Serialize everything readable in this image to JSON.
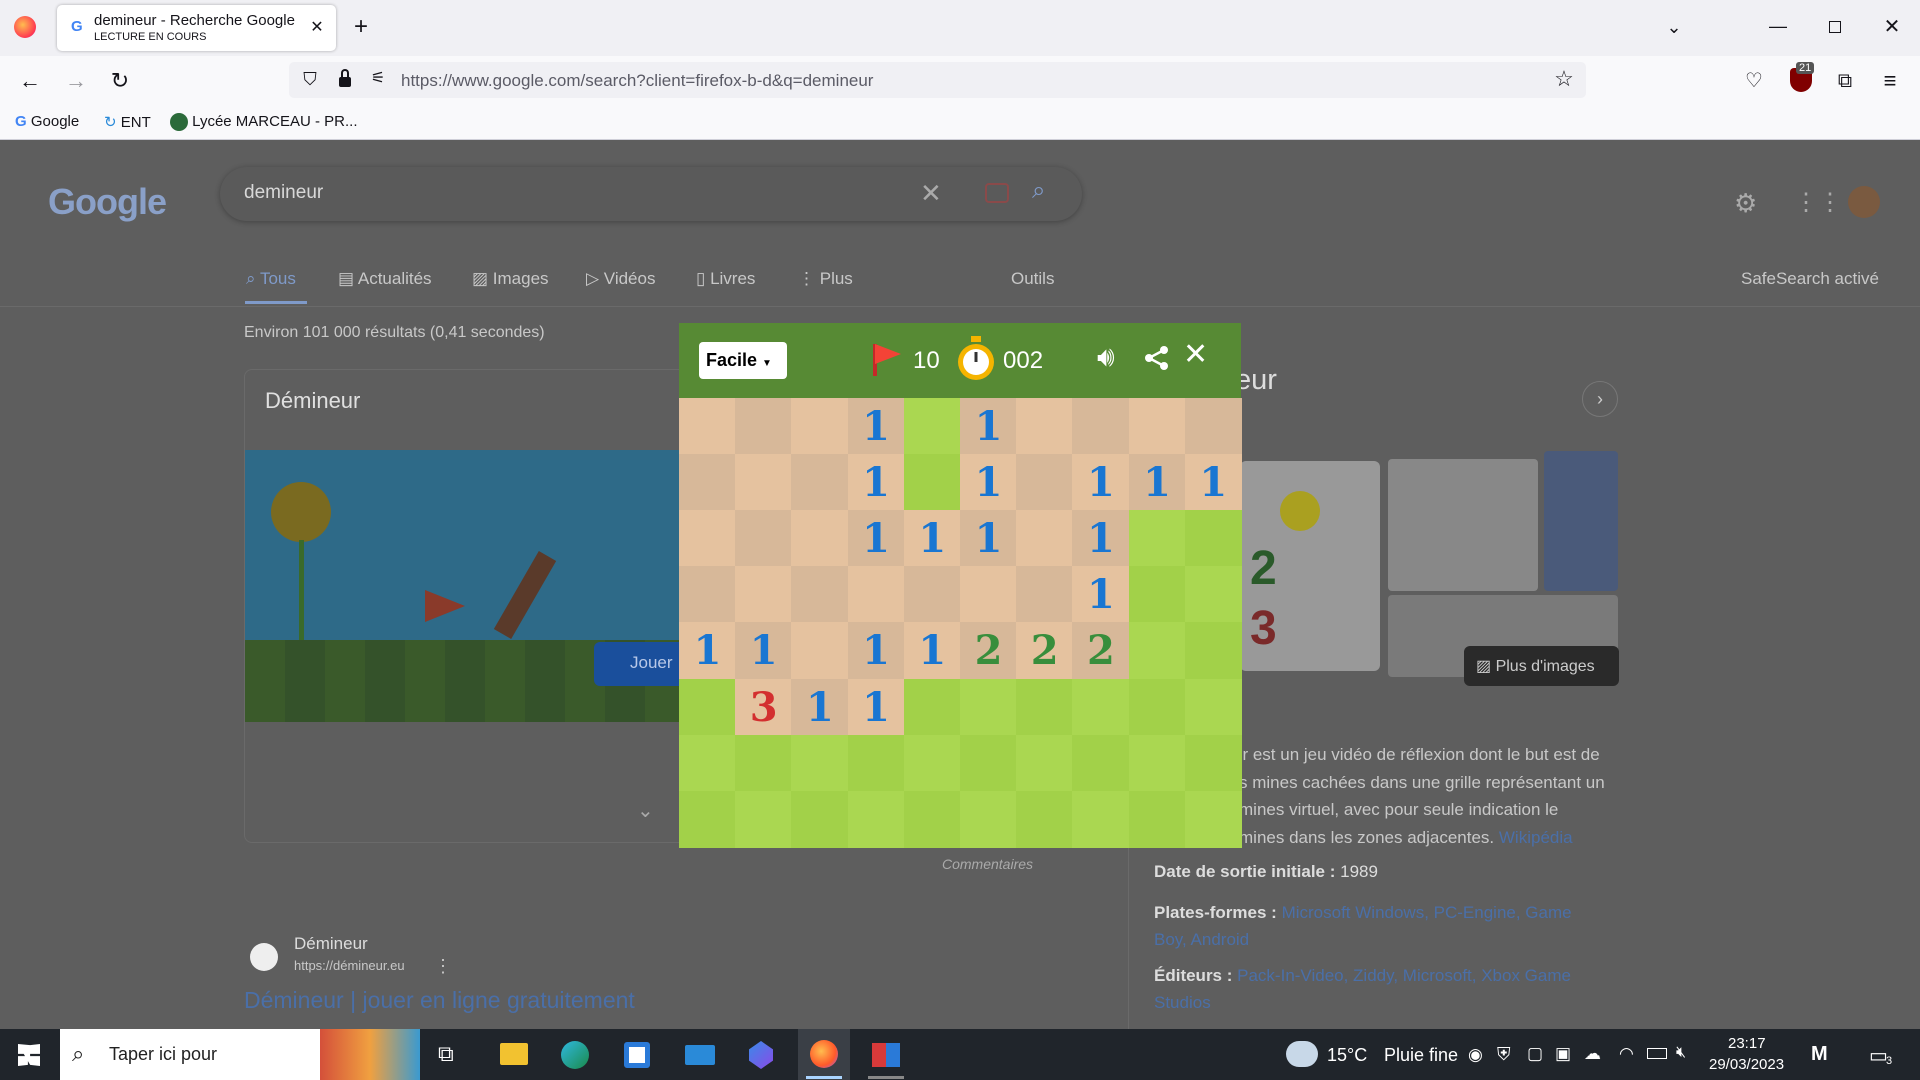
{
  "browser": {
    "tab_title": "demineur - Recherche Google",
    "tab_subtitle": "LECTURE EN COURS",
    "url": "https://www.google.com/search?client=firefox-b-d&q=demineur",
    "ext_badge": "21",
    "bookmarks": [
      "Google",
      "ENT",
      "Lycée MARCEAU - PR..."
    ]
  },
  "google": {
    "query": "demineur",
    "tabs": [
      "Tous",
      "Actualités",
      "Images",
      "Vidéos",
      "Livres",
      "Plus"
    ],
    "tools": "Outils",
    "safesearch": "SafeSearch activé",
    "results_count": "Environ 101 000 résultats (0,41 secondes)",
    "card_title": "Démineur",
    "play_label": "Jouer",
    "feedback": "Commentaires",
    "result_site": "Démineur",
    "result_url": "https://démineur.eu",
    "result_title": "Démineur | jouer en ligne gratuitement",
    "kp_title_fragment": "eur",
    "more_images": "Plus d'images",
    "kp_desc_1": "ur est un jeu vidéo de réflexion dont le but est de",
    "kp_desc_2": "s mines cachées dans une grille représentant un",
    "kp_desc_3": "mines virtuel, avec pour seule indication le",
    "kp_desc_4": "mines dans les zones adjacentes.",
    "wikipedia": "Wikipédia",
    "release_label": "Date de sortie initiale :",
    "release_value": "1989",
    "platforms_label": "Plates-formes :",
    "platforms_line1": "Microsoft Windows, PC-Engine, Game",
    "platforms_line2": "Boy, Android",
    "publishers_label": "Éditeurs :",
    "publishers_line1": "Pack-In-Video, Ziddy, Microsoft, Xbox Game",
    "publishers_line2": "Studios"
  },
  "game": {
    "difficulty": "Facile",
    "flags": "10",
    "timer": "002",
    "grid": [
      [
        "o",
        "o",
        "o",
        "1",
        "h",
        "1",
        "o",
        "o",
        "o",
        "o"
      ],
      [
        "o",
        "o",
        "o",
        "1",
        "h",
        "1",
        "o",
        "1",
        "1",
        "1"
      ],
      [
        "o",
        "o",
        "o",
        "1",
        "1",
        "1",
        "o",
        "1",
        "h",
        "h"
      ],
      [
        "o",
        "o",
        "o",
        "o",
        "o",
        "o",
        "o",
        "1",
        "h",
        "h"
      ],
      [
        "1",
        "1",
        "o",
        "1",
        "1",
        "2",
        "2",
        "2",
        "h",
        "h"
      ],
      [
        "h",
        "3",
        "1",
        "1",
        "h",
        "h",
        "h",
        "h",
        "h",
        "h"
      ],
      [
        "h",
        "h",
        "h",
        "h",
        "h",
        "h",
        "h",
        "h",
        "h",
        "h"
      ],
      [
        "h",
        "h",
        "h",
        "h",
        "h",
        "h",
        "h",
        "h",
        "h",
        "h"
      ]
    ],
    "colors": {
      "open_light": "#e5c29f",
      "open_dark": "#d7b899",
      "hidden_light": "#aad751",
      "hidden_dark": "#a2d149",
      "one": "#1976d2",
      "two": "#388e3c",
      "three": "#d32f2f"
    }
  },
  "taskbar": {
    "search_placeholder": "Taper ici pour",
    "weather": "15°C",
    "weather_desc": "Pluie fine",
    "time": "23:17",
    "date": "29/03/2023",
    "notif_count": "3"
  }
}
